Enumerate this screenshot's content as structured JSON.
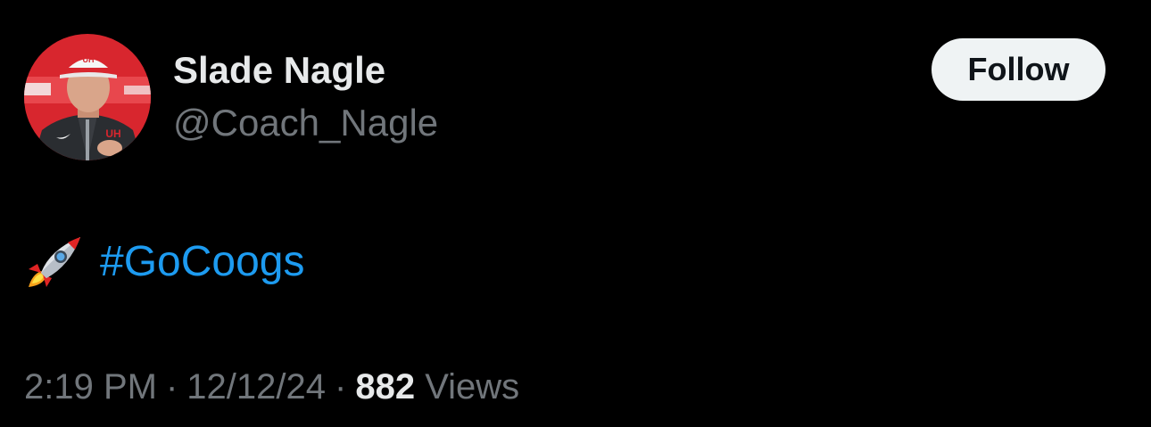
{
  "author": {
    "display_name": "Slade Nagle",
    "handle": "@Coach_Nagle",
    "avatar": "avatar-photo"
  },
  "follow_button": {
    "label": "Follow"
  },
  "tweet": {
    "emoji_icon": "rocket-icon",
    "hashtag": "#GoCoogs"
  },
  "meta": {
    "time": "2:19 PM",
    "separator": "·",
    "date": "12/12/24",
    "views_count": "882",
    "views_label": "Views"
  },
  "colors": {
    "background": "#000000",
    "primary_text": "#e7e9ea",
    "secondary_text": "#71767b",
    "link": "#1d9bf0",
    "follow_button_bg": "#eff3f4",
    "follow_button_text": "#0f1419"
  }
}
